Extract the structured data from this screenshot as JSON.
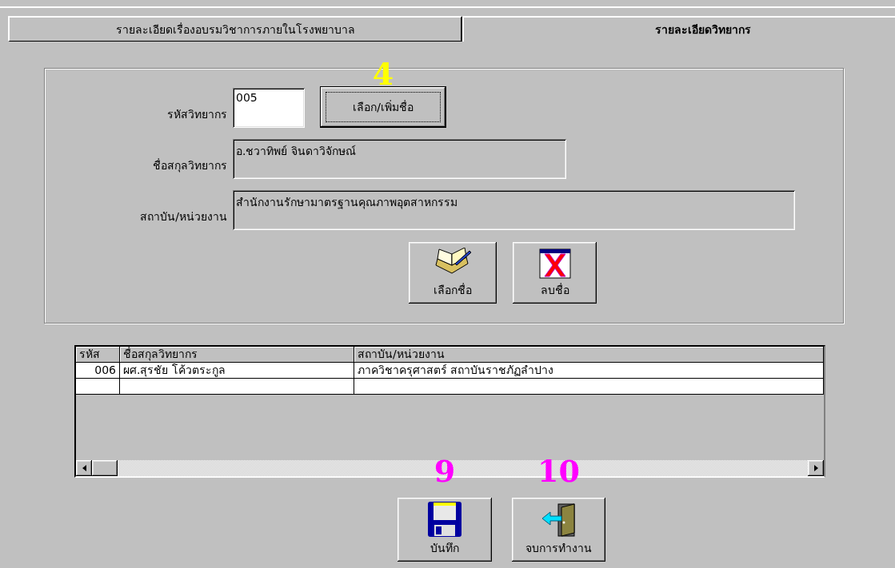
{
  "tabs": [
    {
      "label": "รายละเอียดเรื่องอบรมวิชาการภายในโรงพยาบาล",
      "selected": false
    },
    {
      "label": "รายละเอียดวิทยากร",
      "selected": true
    }
  ],
  "form": {
    "fields": [
      {
        "label": "รหัสวิทยากร",
        "value": "005",
        "kind": "input"
      },
      {
        "label": "ชื่อสกุลวิทยากร",
        "value": "อ.ชวาทิพย์  จินดาวิจักษณ์",
        "kind": "readonly"
      },
      {
        "label": "สถาบัน/หน่วยงาน",
        "value": "สำนักงานรักษามาตรฐานคุณภาพอุตสาหกรรม",
        "kind": "readonly"
      }
    ],
    "pick_button": {
      "label": "เลือก/เพิ่มชื่อ",
      "annotation": "4"
    },
    "actions": [
      {
        "label": "เลือกชื่อ",
        "kind": "book"
      },
      {
        "label": "ลบชื่อ",
        "kind": "delete"
      }
    ]
  },
  "grid": {
    "columns": [
      "รหัส",
      "ชื่อสกุลวิทยากร",
      "สถาบัน/หน่วยงาน"
    ],
    "rows": [
      [
        "006",
        "ผศ.สุรชัย  โค้วตระกูล",
        "ภาควิชาครุศาสตร์ สถาบันราชภัฏลำปาง"
      ]
    ]
  },
  "footer": [
    {
      "label": "บันทึก",
      "kind": "disk",
      "annotation": "9"
    },
    {
      "label": "จบการทำงาน",
      "kind": "door",
      "annotation": "10"
    }
  ]
}
